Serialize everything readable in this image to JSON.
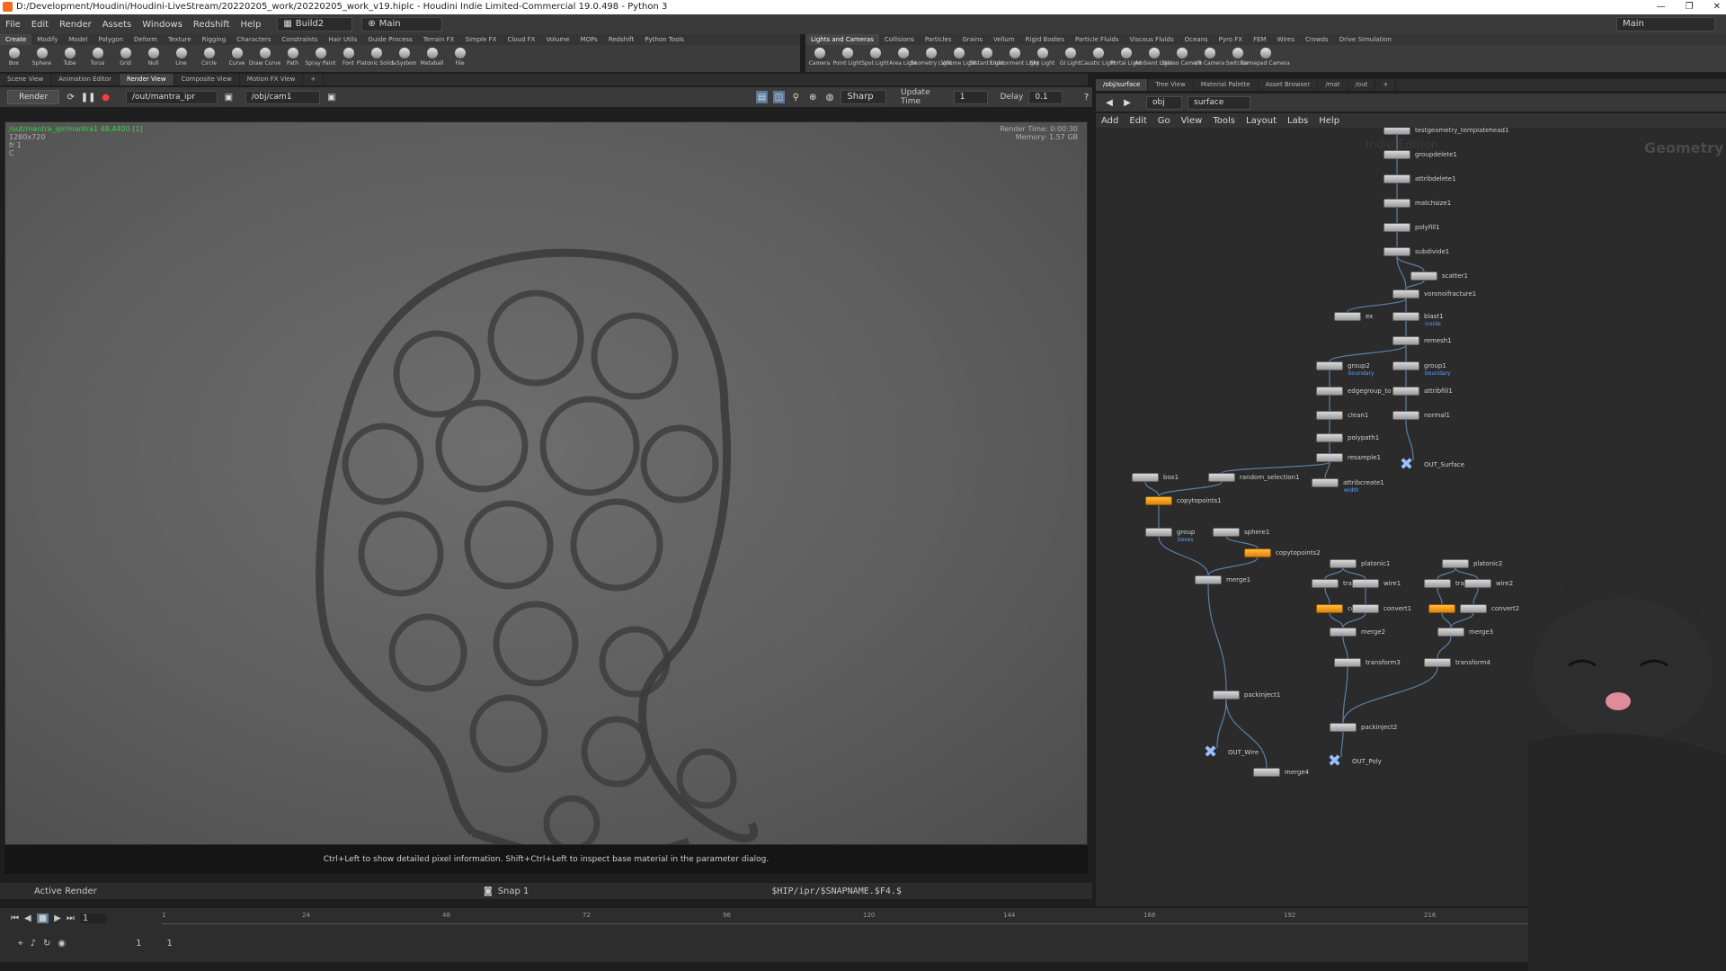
{
  "window": {
    "title": "D:/Development/Houdini/Houdini-LiveStream/20220205_work/20220205_work_v19.hiplc - Houdini Indie Limited-Commercial 19.0.498 - Python 3",
    "buttons": [
      "—",
      "❐",
      "✕"
    ]
  },
  "menubar": {
    "items": [
      "File",
      "Edit",
      "Render",
      "Assets",
      "Windows",
      "Redshift",
      "Help"
    ],
    "desktop": "Build2",
    "desktop_right": "Main",
    "main_label": "Main"
  },
  "shelf_left": {
    "tabs": [
      "Create",
      "Modify",
      "Model",
      "Polygon",
      "Deform",
      "Texture",
      "Rigging",
      "Characters",
      "Constraints",
      "Hair Utils",
      "Guide Process",
      "Terrain FX",
      "Simple FX",
      "Cloud FX",
      "Volume",
      "MOPs",
      "Redshift",
      "Python Tools"
    ],
    "tools": [
      "Box",
      "Sphere",
      "Tube",
      "Torus",
      "Grid",
      "Null",
      "Line",
      "Circle",
      "Curve",
      "Draw Curve",
      "Path",
      "Spray Paint",
      "Font",
      "Platonic Solids",
      "L-System",
      "Metaball",
      "File"
    ]
  },
  "shelf_right": {
    "tabs": [
      "Lights and Cameras",
      "Collisions",
      "Particles",
      "Grains",
      "Vellum",
      "Rigid Bodies",
      "Particle Fluids",
      "Viscous Fluids",
      "Oceans",
      "Pyro FX",
      "FEM",
      "Wires",
      "Crowds",
      "Drive Simulation"
    ],
    "tools": [
      "Camera",
      "Point Light",
      "Spot Light",
      "Area Light",
      "Geometry Light",
      "Volume Light",
      "Distant Light",
      "Environment Light",
      "Sky Light",
      "GI Light",
      "Caustic Light",
      "Portal Light",
      "Ambient Light",
      "Stereo Camera",
      "VR Camera",
      "Switcher",
      "Gamepad Camera"
    ]
  },
  "left_pane": {
    "tabs": [
      "Scene View",
      "Animation Editor",
      "Render View",
      "Composite View",
      "Motion FX View"
    ],
    "active_tab": "Render View",
    "render_button": "Render",
    "rop_path": "/out/mantra_ipr",
    "camera_path": "/obj/cam1",
    "quality": "Sharp",
    "update_time_label": "Update Time",
    "update_time_value": "1",
    "delay_label": "Delay",
    "delay_value": "0.1"
  },
  "viewport": {
    "hud_path": "/out/mantra_ipr/mantra1 48,4400 [1]",
    "hud_res": "1280x720",
    "hud_frame": "fr 1",
    "hud_c": "C",
    "render_time": "Render Time: 0:00:30",
    "memory": "Memory: 1.57 GB",
    "hint": "Ctrl+Left to show detailed pixel information. Shift+Ctrl+Left to inspect base material in the parameter dialog."
  },
  "render_status": {
    "active_render": "Active Render",
    "snap": "Snap 1",
    "output_path": "$HIP/ipr/$SNAPNAME.$F4.$"
  },
  "right_pane": {
    "tabs": [
      "/obj/surface",
      "Tree View",
      "Material Palette",
      "Asset Browser",
      "/mat",
      "/out"
    ],
    "path_root": "obj",
    "path_current": "surface",
    "menu": [
      "Add",
      "Edit",
      "Go",
      "View",
      "Tools",
      "Layout",
      "Labs",
      "Help"
    ],
    "context_label": "Geometry",
    "watermark": "Indie Edition"
  },
  "nodes": [
    {
      "name": "testgeometry_templatehead1",
      "color": "gray"
    },
    {
      "name": "groupdelete1",
      "color": "gray"
    },
    {
      "name": "attribdelete1",
      "color": "gray"
    },
    {
      "name": "matchsize1",
      "color": "gray"
    },
    {
      "name": "polyfill1",
      "color": "gray"
    },
    {
      "name": "subdivide1",
      "color": "gray"
    },
    {
      "name": "scatter1",
      "color": "gray"
    },
    {
      "name": "voronoifracture1",
      "color": "gray"
    },
    {
      "name": "ex",
      "color": "gray"
    },
    {
      "name": "blast1",
      "color": "gray",
      "sub": "inside"
    },
    {
      "name": "remesh1",
      "color": "gray"
    },
    {
      "name": "group2",
      "color": "gray",
      "sub": "boundary"
    },
    {
      "name": "group1",
      "color": "gray",
      "sub": "boundary"
    },
    {
      "name": "edgegroup_to",
      "color": "gray"
    },
    {
      "name": "attribfill1",
      "color": "gray"
    },
    {
      "name": "clean1",
      "color": "gray"
    },
    {
      "name": "normal1",
      "color": "gray"
    },
    {
      "name": "polypath1",
      "color": "gray"
    },
    {
      "name": "OUT_Surface",
      "color": "out"
    },
    {
      "name": "resample1",
      "color": "gray"
    },
    {
      "name": "box1",
      "color": "gray"
    },
    {
      "name": "random_selection1",
      "color": "gray"
    },
    {
      "name": "attribcreate1",
      "color": "gray",
      "sub": "width"
    },
    {
      "name": "copytopoints1",
      "color": "orange"
    },
    {
      "name": "group",
      "color": "gray",
      "sub": "boxes"
    },
    {
      "name": "sphere1",
      "color": "gray"
    },
    {
      "name": "copytopoints2",
      "color": "orange"
    },
    {
      "name": "platonic1",
      "color": "gray"
    },
    {
      "name": "platonic2",
      "color": "gray"
    },
    {
      "name": "merge1",
      "color": "gray"
    },
    {
      "name": "trans",
      "color": "gray"
    },
    {
      "name": "wire1",
      "color": "gray"
    },
    {
      "name": "tra",
      "color": "gray"
    },
    {
      "name": "wire2",
      "color": "gray"
    },
    {
      "name": "co",
      "color": "orange"
    },
    {
      "name": "convert1",
      "color": "gray"
    },
    {
      "name": "co",
      "color": "orange"
    },
    {
      "name": "convert2",
      "color": "gray"
    },
    {
      "name": "merge2",
      "color": "gray"
    },
    {
      "name": "merge3",
      "color": "gray"
    },
    {
      "name": "transform3",
      "color": "gray"
    },
    {
      "name": "transform4",
      "color": "gray"
    },
    {
      "name": "packinject1",
      "color": "gray"
    },
    {
      "name": "packinject2",
      "color": "gray"
    },
    {
      "name": "OUT_Wire",
      "color": "out"
    },
    {
      "name": "OUT_Poly",
      "color": "out"
    },
    {
      "name": "merge4",
      "color": "gray"
    }
  ],
  "timeline": {
    "ticks": [
      "1",
      "24",
      "48",
      "72",
      "96",
      "120",
      "144",
      "168",
      "192",
      "216"
    ],
    "current_frame": "1",
    "range_start": "1",
    "range_start2": "1"
  },
  "colors": {
    "hud_green": "#37d24a",
    "node_orange": "#f0a020",
    "accent_blue": "#5aa0ff"
  }
}
